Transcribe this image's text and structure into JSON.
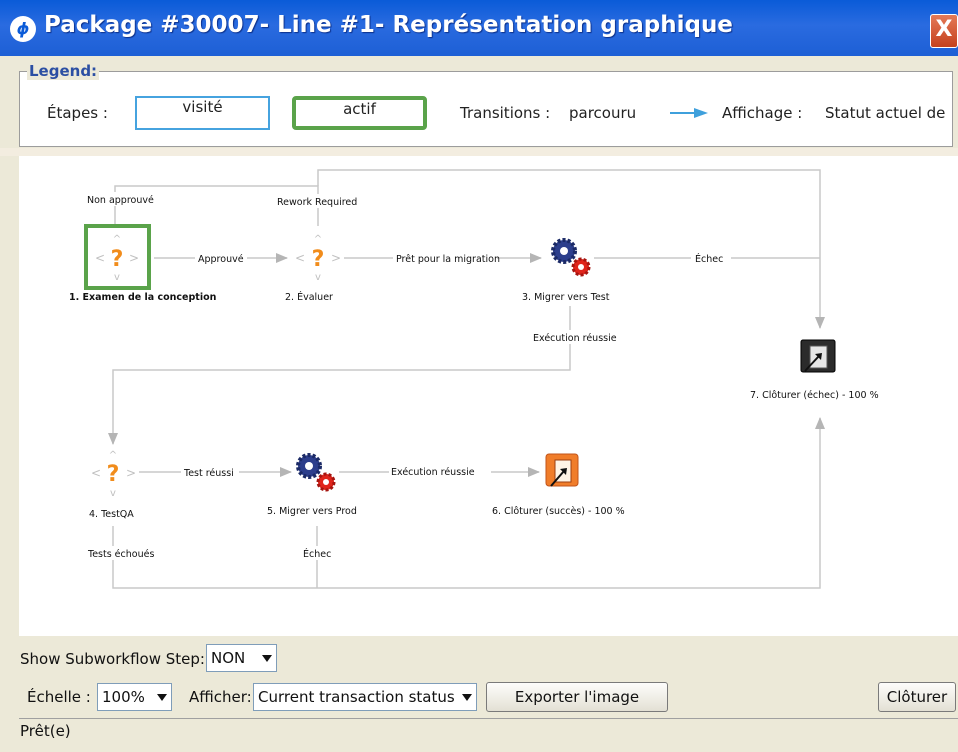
{
  "window": {
    "title": "Package #30007- Line #1- Représentation graphique",
    "logo": "hp-logo",
    "close_label": "X"
  },
  "legend": {
    "title": "Legend:",
    "steps_label": "Étapes :",
    "visited_label": "visité",
    "active_label": "actif",
    "transitions_label": "Transitions :",
    "traversed_label": "parcouru",
    "display_label": "Affichage :",
    "current_status_label": "Statut actuel de",
    "visited_color": "#46a3df",
    "active_color": "#5aa34a",
    "arrow_color": "#3fa0dc"
  },
  "workflow": {
    "steps": [
      {
        "label": "1.  Examen de la conception",
        "icon": "question-icon",
        "active": true
      },
      {
        "label": "2.   Évaluer",
        "icon": "question-icon",
        "active": false
      },
      {
        "label": "3.  Migrer vers Test",
        "icon": "gears-icon",
        "active": false
      },
      {
        "label": "4.  TestQA",
        "icon": "question-icon",
        "active": false
      },
      {
        "label": "5.   Migrer vers Prod",
        "icon": "gears-icon",
        "active": false
      },
      {
        "label": "6.   Clôturer (succès) - 100 %",
        "icon": "close-success-icon",
        "active": false
      },
      {
        "label": "7.  Clôturer (échec) - 100 %",
        "icon": "close-failure-icon",
        "active": false
      }
    ],
    "transitions": {
      "not_approved": "Non approuvé",
      "approved": "Approuvé",
      "rework_required": "Rework Required",
      "ready_for_migration": "Prêt pour la migration",
      "failure_1": "Échec",
      "execution_success_1": "Exécution réussie",
      "test_success": "Test réussi",
      "execution_success_2": "Exécution réussie",
      "tests_failed": "Tests échoués",
      "failure_2": "Échec"
    }
  },
  "controls": {
    "subworkflow_label": "Show Subworkflow Step:",
    "subworkflow_value": "NON",
    "scale_label": "Échelle :",
    "scale_value": "100%",
    "display_label": "Afficher:",
    "display_value": "Current transaction status",
    "export_button": "Exporter l'image",
    "close_button": "Clôturer"
  },
  "status": {
    "text": "Prêt(e)"
  }
}
